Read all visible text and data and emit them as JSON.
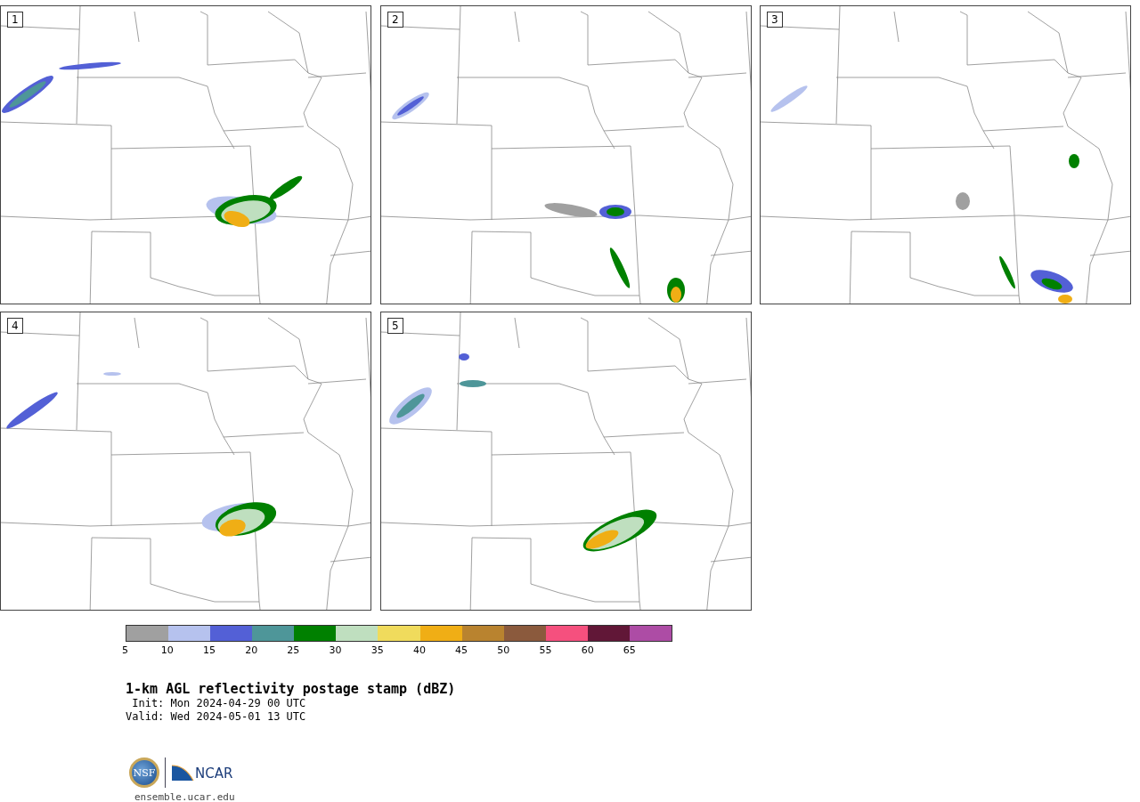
{
  "panels": [
    {
      "number": "1"
    },
    {
      "number": "2"
    },
    {
      "number": "3"
    },
    {
      "number": "4"
    },
    {
      "number": "5"
    }
  ],
  "colorbar": {
    "bins": [
      {
        "color": "#a0a0a0"
      },
      {
        "color": "#b6c2ee"
      },
      {
        "color": "#5360d6"
      },
      {
        "color": "#4e9699"
      },
      {
        "color": "#008000"
      },
      {
        "color": "#bfdfbf"
      },
      {
        "color": "#f0db5c"
      },
      {
        "color": "#f0ae15"
      },
      {
        "color": "#b9832f"
      },
      {
        "color": "#8b5a3d"
      },
      {
        "color": "#f5507e"
      },
      {
        "color": "#611737"
      },
      {
        "color": "#ad4ca5"
      }
    ],
    "ticks": [
      "5",
      "10",
      "15",
      "20",
      "25",
      "30",
      "35",
      "40",
      "45",
      "50",
      "55",
      "60",
      "65"
    ]
  },
  "title": "1-km AGL reflectivity postage stamp (dBZ)",
  "init": " Init: Mon 2024-04-29 00 UTC",
  "valid": "Valid: Wed 2024-05-01 13 UTC",
  "logo": {
    "left": "NSF",
    "right": "NCAR"
  },
  "site": "ensemble.ucar.edu"
}
